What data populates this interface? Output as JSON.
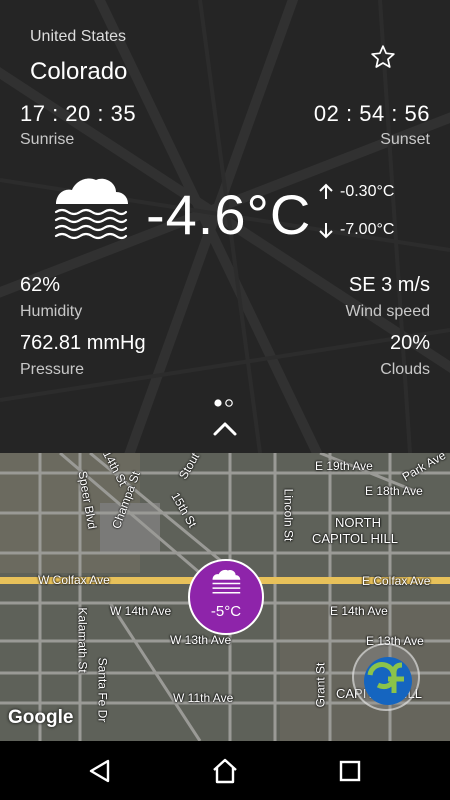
{
  "location": {
    "country": "United States",
    "region": "Colorado"
  },
  "sun": {
    "sunrise_time": "17 : 20 : 35",
    "sunrise_label": "Sunrise",
    "sunset_time": "02 : 54 : 56",
    "sunset_label": "Sunset"
  },
  "current": {
    "temperature": "-4.6°C",
    "high": "-0.30°C",
    "low": "-7.00°C",
    "icon": "fog-cloud-icon"
  },
  "details": {
    "humidity_value": "62%",
    "humidity_label": "Humidity",
    "wind_value": "SE 3 m/s",
    "wind_label": "Wind speed",
    "pressure_value": "762.81 mmHg",
    "pressure_label": "Pressure",
    "clouds_value": "20%",
    "clouds_label": "Clouds"
  },
  "pager": {
    "pages": 2,
    "active": 1
  },
  "map": {
    "marker_temp": "-5°C",
    "attribution": "Google",
    "street_labels": [
      "14th St",
      "Stout",
      "Park Ave",
      "E 19th Ave",
      "E 18th Ave",
      "Speer Blvd",
      "Champa St",
      "15th St",
      "Lincoln St",
      "NORTH",
      "CAPITOL HILL",
      "W Colfax Ave",
      "E Colfax Ave",
      "W 14th Ave",
      "E 14th Ave",
      "W 13th Ave",
      "E 13th Ave",
      "Kalamath St",
      "Santa Fe Dr",
      "W 11th Ave",
      "Grant St",
      "CAPITOL HILL"
    ]
  },
  "colors": {
    "marker": "#8e24aa",
    "panel_overlay": "rgba(20,20,20,0.55)",
    "fab_logo_blue": "#1565c0",
    "fab_logo_green": "#8bc34a"
  },
  "nav": {
    "back": "back-icon",
    "home": "home-icon",
    "recents": "recents-icon"
  }
}
